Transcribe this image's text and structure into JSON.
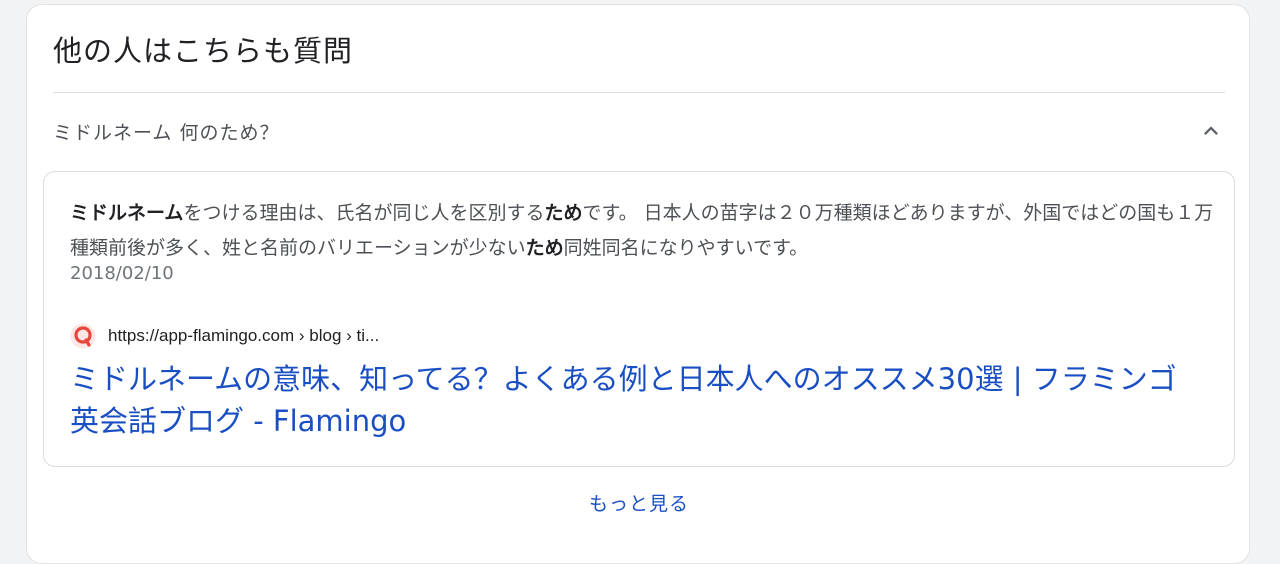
{
  "section": {
    "title": "他の人はこちらも質問"
  },
  "question": {
    "text": "ミドルネーム 何のため？",
    "expanded_icon": "chevron-up-icon"
  },
  "answer": {
    "snippet_parts": [
      {
        "text": "ミドルネーム",
        "bold": true
      },
      {
        "text": "をつける理由は、氏名が同じ人を区別する",
        "bold": false
      },
      {
        "text": "ため",
        "bold": true
      },
      {
        "text": "です。 日本人の苗字は２０万種類ほどありますが、外国ではどの国も１万種類前後が多く、姓と名前のバリエーションが少ない",
        "bold": false
      },
      {
        "text": "ため",
        "bold": true
      },
      {
        "text": "同姓同名になりやすいです。",
        "bold": false
      }
    ],
    "date": "2018/02/10",
    "source_url": "https://app-flamingo.com › blog › ti...",
    "favicon_icon": "flamingo-favicon-icon",
    "result_title": "ミドルネームの意味、知ってる？よくある例と日本人へのオススメ30選 | フラミンゴ 英会話ブログ - Flamingo"
  },
  "footer": {
    "more_label": "もっと見る"
  },
  "colors": {
    "link": "#1a4fc4",
    "text": "#4d5156",
    "title": "#202124",
    "favicon": "#e8453c"
  }
}
